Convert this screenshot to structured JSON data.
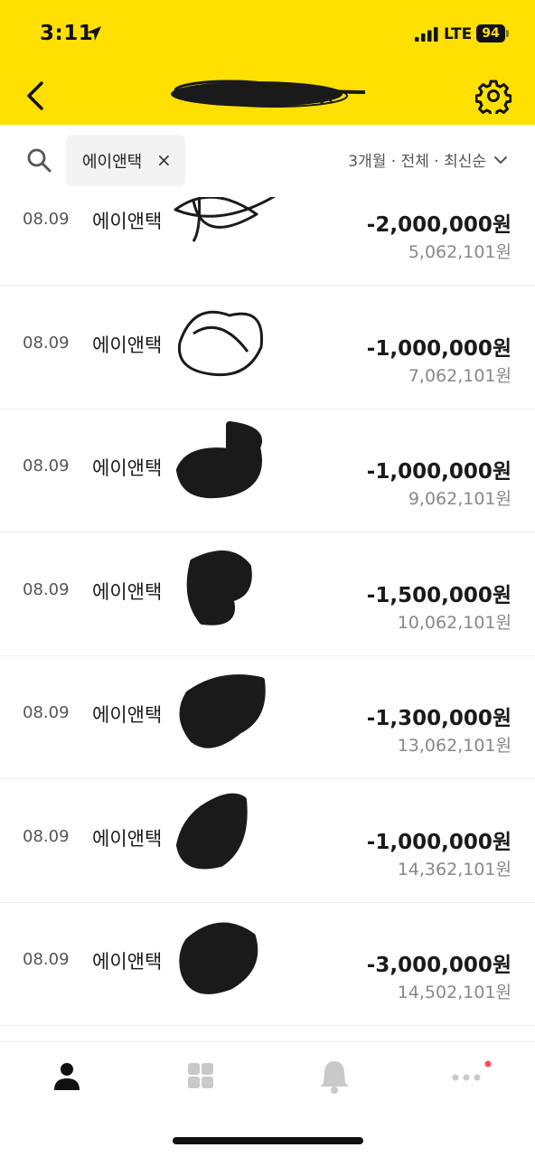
{
  "status_bar": {
    "time": "3:11",
    "network": "LTE",
    "battery": "94"
  },
  "nav": {
    "back_icon": "chevron-left-icon",
    "title_redacted": true,
    "settings_icon": "gear-icon"
  },
  "filter": {
    "search_icon": "search-icon",
    "chip_label": "에이앤택",
    "chip_close": "×",
    "summary": "3개월 · 전체 · 최신순",
    "summary_icon": "chevron-down-icon"
  },
  "transactions": [
    {
      "date": "08.09",
      "name": "에이앤택",
      "amount": "-2,000,000원",
      "balance": "5,062,101원"
    },
    {
      "date": "08.09",
      "name": "에이앤택",
      "amount": "-1,000,000원",
      "balance": "7,062,101원"
    },
    {
      "date": "08.09",
      "name": "에이앤택",
      "amount": "-1,000,000원",
      "balance": "9,062,101원"
    },
    {
      "date": "08.09",
      "name": "에이앤택",
      "amount": "-1,500,000원",
      "balance": "10,062,101원"
    },
    {
      "date": "08.09",
      "name": "에이앤택",
      "amount": "-1,300,000원",
      "balance": "13,062,101원"
    },
    {
      "date": "08.09",
      "name": "에이앤택",
      "amount": "-1,000,000원",
      "balance": "14,362,101원"
    },
    {
      "date": "08.09",
      "name": "에이앤택",
      "amount": "-3,000,000원",
      "balance": "14,502,101원"
    }
  ],
  "tabbar": {
    "tabs": [
      {
        "icon": "person-icon",
        "active": true
      },
      {
        "icon": "grid-icon",
        "active": false
      },
      {
        "icon": "bell-icon",
        "active": false
      },
      {
        "icon": "more-icon",
        "active": false,
        "badge": true
      }
    ]
  },
  "colors": {
    "header_bg": "#FFE000",
    "text_primary": "#1a1a1a",
    "text_secondary": "#888888",
    "badge": "#FF4D4D"
  }
}
